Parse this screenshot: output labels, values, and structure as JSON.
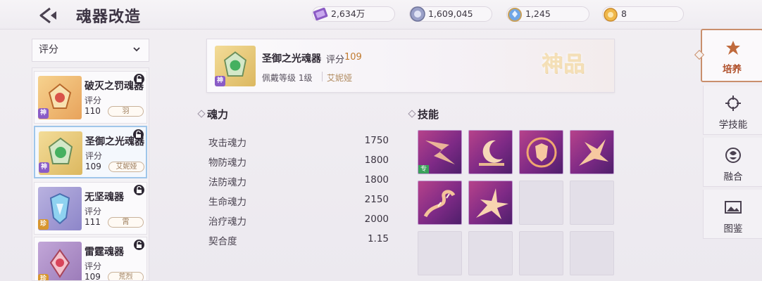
{
  "header": {
    "title": "魂器改造",
    "currencies": [
      {
        "icon": "purple-ticket-icon",
        "value": "2,634万"
      },
      {
        "icon": "soul-coin-icon",
        "value": "1,609,045"
      },
      {
        "icon": "blue-gem-icon",
        "value": "1,245"
      },
      {
        "icon": "gold-token-icon",
        "value": "8"
      }
    ]
  },
  "filter": {
    "label": "评分"
  },
  "list": [
    {
      "name": "破灭之罚魂器",
      "score_label": "评分",
      "score": "110",
      "tag": "羽",
      "tier": "神",
      "thumb": "orange-crest-icon",
      "tier_color": "#8a5cc7"
    },
    {
      "name": "圣御之光魂器",
      "score_label": "评分",
      "score": "109",
      "tag": "艾妮娅",
      "tier": "神",
      "thumb": "green-crest-icon",
      "tier_color": "#8a5cc7"
    },
    {
      "name": "无坚魂器",
      "score_label": "评分",
      "score": "111",
      "tag": "霄",
      "tier": "珍",
      "thumb": "blue-crest-icon",
      "tier_color": "#d8962e"
    },
    {
      "name": "雷霆魂器",
      "score_label": "评分",
      "score": "109",
      "tag": "荒烈",
      "tier": "珍",
      "thumb": "red-crest-icon",
      "tier_color": "#d8962e"
    }
  ],
  "detail": {
    "name": "圣御之光魂器",
    "score_label": "评分",
    "score": "109",
    "level_text": "佩戴等级 1级",
    "hero": "艾妮娅",
    "tier": "神",
    "rank_text": "神品"
  },
  "soul_power": {
    "title": "魂力",
    "stats": [
      {
        "label": "攻击魂力",
        "value": "1750"
      },
      {
        "label": "物防魂力",
        "value": "1800"
      },
      {
        "label": "法防魂力",
        "value": "1800"
      },
      {
        "label": "生命魂力",
        "value": "2150"
      },
      {
        "label": "治疗魂力",
        "value": "2000"
      },
      {
        "label": "契合度",
        "value": "1.15"
      }
    ]
  },
  "skills": {
    "title": "技能",
    "exclusive_badge": "专",
    "slots": [
      {
        "icon": "lightning-arrow-skill-icon",
        "filled": true,
        "exclusive": true
      },
      {
        "icon": "crescent-moon-skill-icon",
        "filled": true,
        "exclusive": false
      },
      {
        "icon": "shield-skill-icon",
        "filled": true,
        "exclusive": false
      },
      {
        "icon": "burst-skill-icon",
        "filled": true,
        "exclusive": false
      },
      {
        "icon": "thorn-vine-skill-icon",
        "filled": true,
        "exclusive": false
      },
      {
        "icon": "explosion-skill-icon",
        "filled": true,
        "exclusive": false
      },
      {
        "icon": "empty-slot",
        "filled": false
      },
      {
        "icon": "empty-slot",
        "filled": false
      },
      {
        "icon": "empty-slot",
        "filled": false
      },
      {
        "icon": "empty-slot",
        "filled": false
      },
      {
        "icon": "empty-slot",
        "filled": false
      },
      {
        "icon": "empty-slot",
        "filled": false
      }
    ]
  },
  "side_tabs": [
    {
      "label": "培养",
      "icon": "cultivate-icon",
      "active": true
    },
    {
      "label": "学技能",
      "icon": "learn-skill-icon",
      "active": false
    },
    {
      "label": "融合",
      "icon": "fusion-icon",
      "active": false
    },
    {
      "label": "图鉴",
      "icon": "gallery-icon",
      "active": false
    }
  ]
}
